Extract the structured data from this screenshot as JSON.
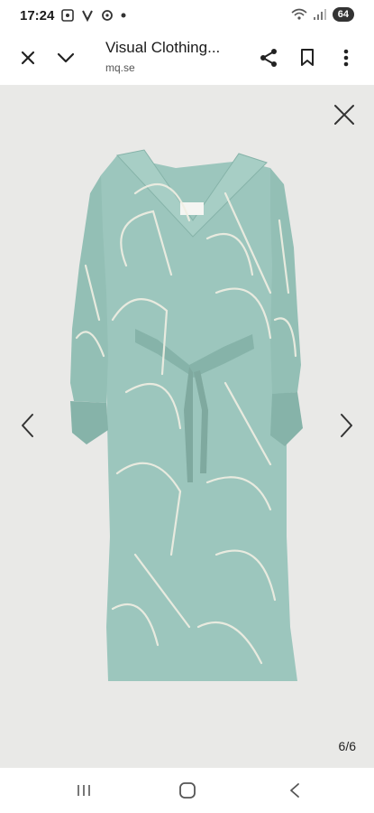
{
  "status_bar": {
    "time": "17:24",
    "battery": "64"
  },
  "toolbar": {
    "title": "Visual Clothing...",
    "url": "mq.se"
  },
  "viewer": {
    "counter": "6/6"
  },
  "colors": {
    "dress": "#9cc6bd",
    "dress_shade": "#86b3a9",
    "pattern": "#f1efe3",
    "viewer_bg": "#e9e9e7"
  },
  "icons": [
    "close-icon",
    "chevron-down-icon",
    "share-icon",
    "bookmark-icon",
    "more-vert-icon",
    "prev-arrow-icon",
    "next-arrow-icon",
    "recent-apps-icon",
    "home-icon",
    "back-icon"
  ]
}
